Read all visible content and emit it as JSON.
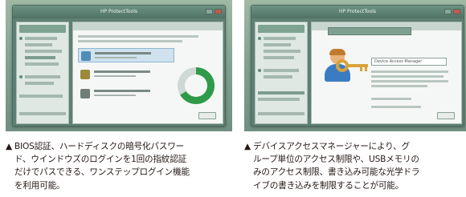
{
  "left_panel": {
    "screenshot_title": "HP ProtectTools",
    "caption_lines": [
      "BIOS認証、ハードディスクの暗号化パスワー",
      "ド、ウインドウズのログインを1回の指紋認証",
      "だけでパスできる、ワンステップログイン機能",
      "を利用可能。"
    ]
  },
  "right_panel": {
    "screenshot_title": "HP ProtectTools",
    "dialog_title": "Device Access Manager",
    "caption_lines": [
      "デバイスアクセスマネージャーにより、グ",
      "ループ単位のアクセス制限や、USBメモリの",
      "みのアクセス制限、書き込み可能な光学ドラ",
      "イブの書き込みを制限することが可能。"
    ]
  },
  "marker": "▲",
  "colors": {
    "caption_text": "#231815",
    "window_frame": "#5f7f74",
    "gauge_green": "#2f9a4a",
    "key_gold": "#d9a33b",
    "user_blue": "#3a7cc1"
  },
  "icons": [
    "fingerprint-icon",
    "gauge-icon",
    "user-icon",
    "key-icon"
  ]
}
